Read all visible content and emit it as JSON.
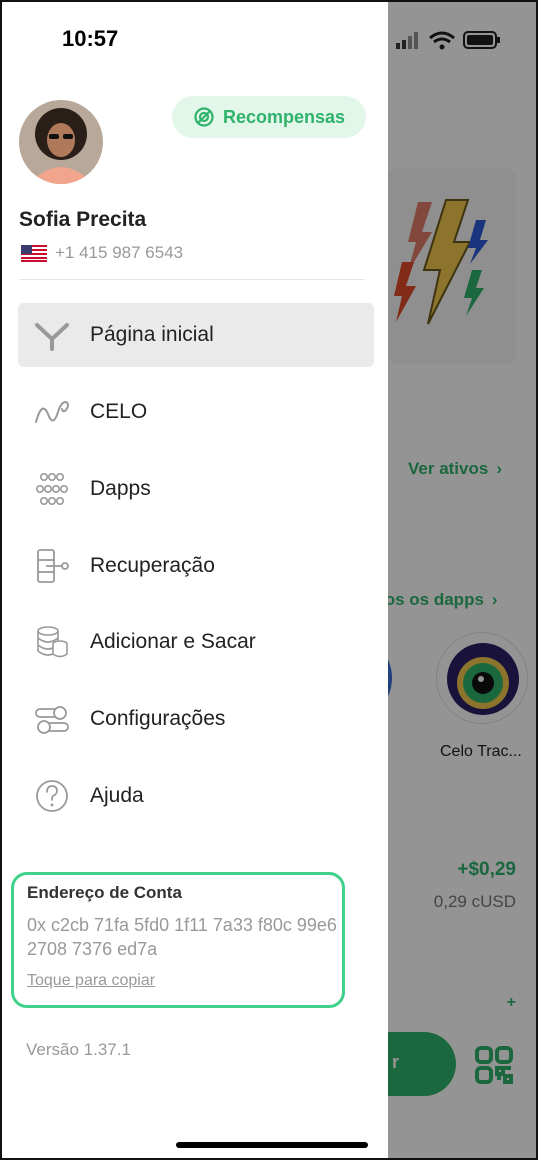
{
  "status_bar": {
    "time": "10:57"
  },
  "profile": {
    "name": "Sofia Precita",
    "phone": "+1 415 987 6543",
    "rewards_label": "Recompensas"
  },
  "menu": {
    "items": [
      {
        "label": "Página inicial",
        "icon": "home-icon",
        "active": true
      },
      {
        "label": "CELO",
        "icon": "celo-icon",
        "active": false
      },
      {
        "label": "Dapps",
        "icon": "dapps-icon",
        "active": false
      },
      {
        "label": "Recuperação",
        "icon": "recovery-icon",
        "active": false
      },
      {
        "label": "Adicionar e Sacar",
        "icon": "coins-icon",
        "active": false
      },
      {
        "label": "Configurações",
        "icon": "settings-icon",
        "active": false
      },
      {
        "label": "Ajuda",
        "icon": "help-icon",
        "active": false
      }
    ]
  },
  "account": {
    "title": "Endereço de Conta",
    "address": "0x c2cb 71fa 5fd0 1f11 7a33 f80c 99e6 2708 7376 ed7a",
    "copy_label": "Toque para copiar"
  },
  "version": "Versão 1.37.1",
  "background": {
    "ver_ativos": "Ver ativos",
    "todos_dapps": "los os dapps",
    "dapp_name": "Celo Trac...",
    "amount": "+$0,29",
    "amount_sub": "0,29 cUSD",
    "plus": "+",
    "button_fragment": "r"
  },
  "colors": {
    "accent": "#2fb36b",
    "accent_light": "#e3f6ea",
    "address_border": "#3fd08a"
  }
}
